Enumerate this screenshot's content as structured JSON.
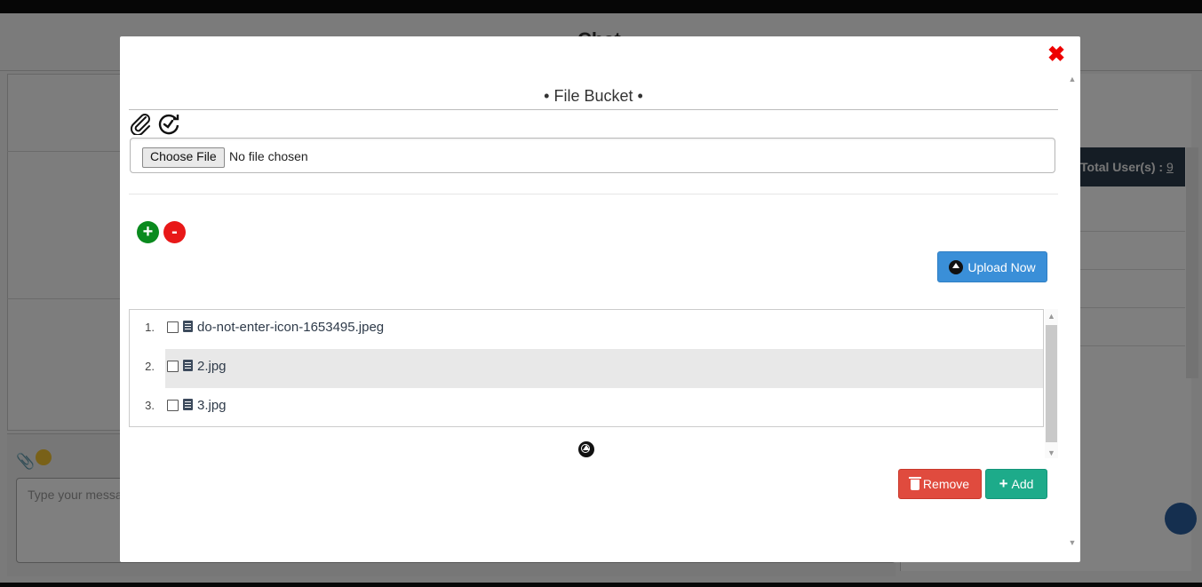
{
  "background": {
    "title": "Chat",
    "message_placeholder": "Type your message",
    "total_users_label": "Total User(s) :",
    "total_users_count": "9"
  },
  "modal": {
    "title": "• File Bucket •",
    "close_icon": "close-x-icon",
    "tool_icons": [
      "paperclip-icon",
      "clock-refresh-icon"
    ],
    "file_input": {
      "button_label": "Choose File",
      "status_text": "No file chosen"
    },
    "add_row_icon": "plus-circle-icon",
    "remove_row_icon": "minus-circle-icon",
    "upload_button": {
      "label": "Upload Now",
      "icon": "upload-circle-icon"
    },
    "files": [
      {
        "index": "1.",
        "name": "do-not-enter-icon-1653495.jpeg",
        "checked": false
      },
      {
        "index": "2.",
        "name": "2.jpg",
        "checked": false
      },
      {
        "index": "3.",
        "name": "3.jpg",
        "checked": false
      }
    ],
    "remove_button": {
      "label": "Remove",
      "icon": "trash-icon"
    },
    "add_button": {
      "label": "Add",
      "icon": "plus-icon"
    }
  },
  "colors": {
    "close": "#ee0000",
    "upload": "#3a8fd8",
    "remove": "#e04b3e",
    "add": "#1dab8a",
    "plus": "#0a8a1e",
    "minus": "#e81818"
  }
}
